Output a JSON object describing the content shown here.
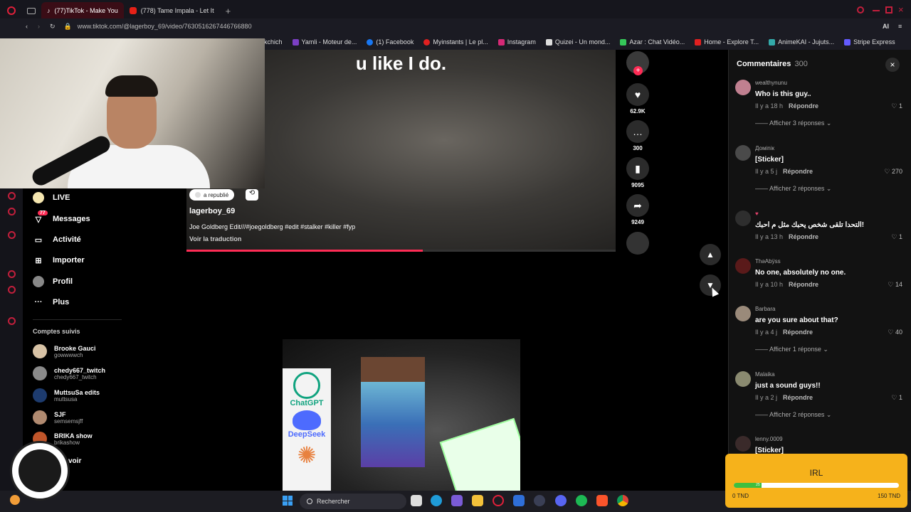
{
  "browser": {
    "tabs": [
      {
        "label": "(77)TikTok - Make You"
      },
      {
        "label": "(778) Tame Impala - Let It"
      }
    ],
    "url": "www.tiktok.com/@lagerboy_69/video/7630516267446766880",
    "bookmarks": [
      "Bakchich",
      "Yamli - Moteur de...",
      "(1) Facebook",
      "Myinstants | Le pl...",
      "Instagram",
      "Quizei - Un mond...",
      "Azar : Chat Vidéo...",
      "Home - Explore T...",
      "AnimeKAI - Jujuts...",
      "Stripe Express"
    ],
    "ai_label": "AI"
  },
  "video": {
    "caption": "u like I do.",
    "repost_label": "a republié",
    "author": "lagerboy_69",
    "description": "Joe Goldberg Edit///#joegoldberg #edit #stalker #killer #fyp",
    "translate": "Voir la traduction",
    "progress_pct": 55,
    "likes": "62.9K",
    "comments": "300",
    "saves": "9095",
    "shares": "9249"
  },
  "nav": {
    "live": "LIVE",
    "messages": "Messages",
    "messages_badge": "77",
    "activity": "Activité",
    "import": "Importer",
    "profile": "Profil",
    "more": "Plus",
    "following_title": "Comptes suivis",
    "following": [
      {
        "name": "Brooke Gauci",
        "handle": "gowwwwch"
      },
      {
        "name": "chedy667_twitch",
        "handle": "chedy667_twitch"
      },
      {
        "name": "MuttsuSa edits",
        "handle": "muttsusa"
      },
      {
        "name": "SJF",
        "handle": "semsemsjff"
      },
      {
        "name": "BRIKA show",
        "handle": "brikashow"
      }
    ],
    "see_more": "voir"
  },
  "comments": {
    "title": "Commentaires",
    "count": "300",
    "reply_label": "Répondre",
    "items": [
      {
        "user": "wealthynunu",
        "text": "Who is this guy..",
        "time": "Il y a 18 h",
        "likes": "1",
        "more": "Afficher 3 réponses"
      },
      {
        "user": "Доміnік",
        "text": "[Sticker]",
        "time": "Il y a 5 j",
        "likes": "270",
        "more": "Afficher 2 réponses"
      },
      {
        "user": "♥",
        "text": "التحدا تلقى شخص يحبك مثل م احبك!",
        "time": "Il y a 13 h",
        "likes": "1",
        "more": ""
      },
      {
        "user": "ThəAbÿss",
        "text": "No one, absolutely no one.",
        "time": "Il y a 10 h",
        "likes": "14",
        "more": ""
      },
      {
        "user": "Barbara",
        "text": "are you sure about that?",
        "time": "Il y a 4 j",
        "likes": "40",
        "more": "Afficher 1 réponse"
      },
      {
        "user": "Malaika",
        "text": "just a sound guys!!",
        "time": "Il y a 2 j",
        "likes": "1",
        "more": "Afficher 2 réponses"
      },
      {
        "user": "lenny.0009",
        "text": "[Sticker]",
        "time": "",
        "likes": "",
        "more": ""
      }
    ]
  },
  "ai_brands": [
    "ChatGPT",
    "DeepSeek"
  ],
  "taskbar": {
    "search_placeholder": "Rechercher"
  },
  "irl_widget": {
    "title": "IRL",
    "current": "25",
    "min": "0 TND",
    "max": "150 TND",
    "progress_fraction": 0.167
  },
  "colors": {
    "accent": "#fe2c55",
    "widget": "#f6b21b",
    "tab_active": "#3a0d16"
  }
}
